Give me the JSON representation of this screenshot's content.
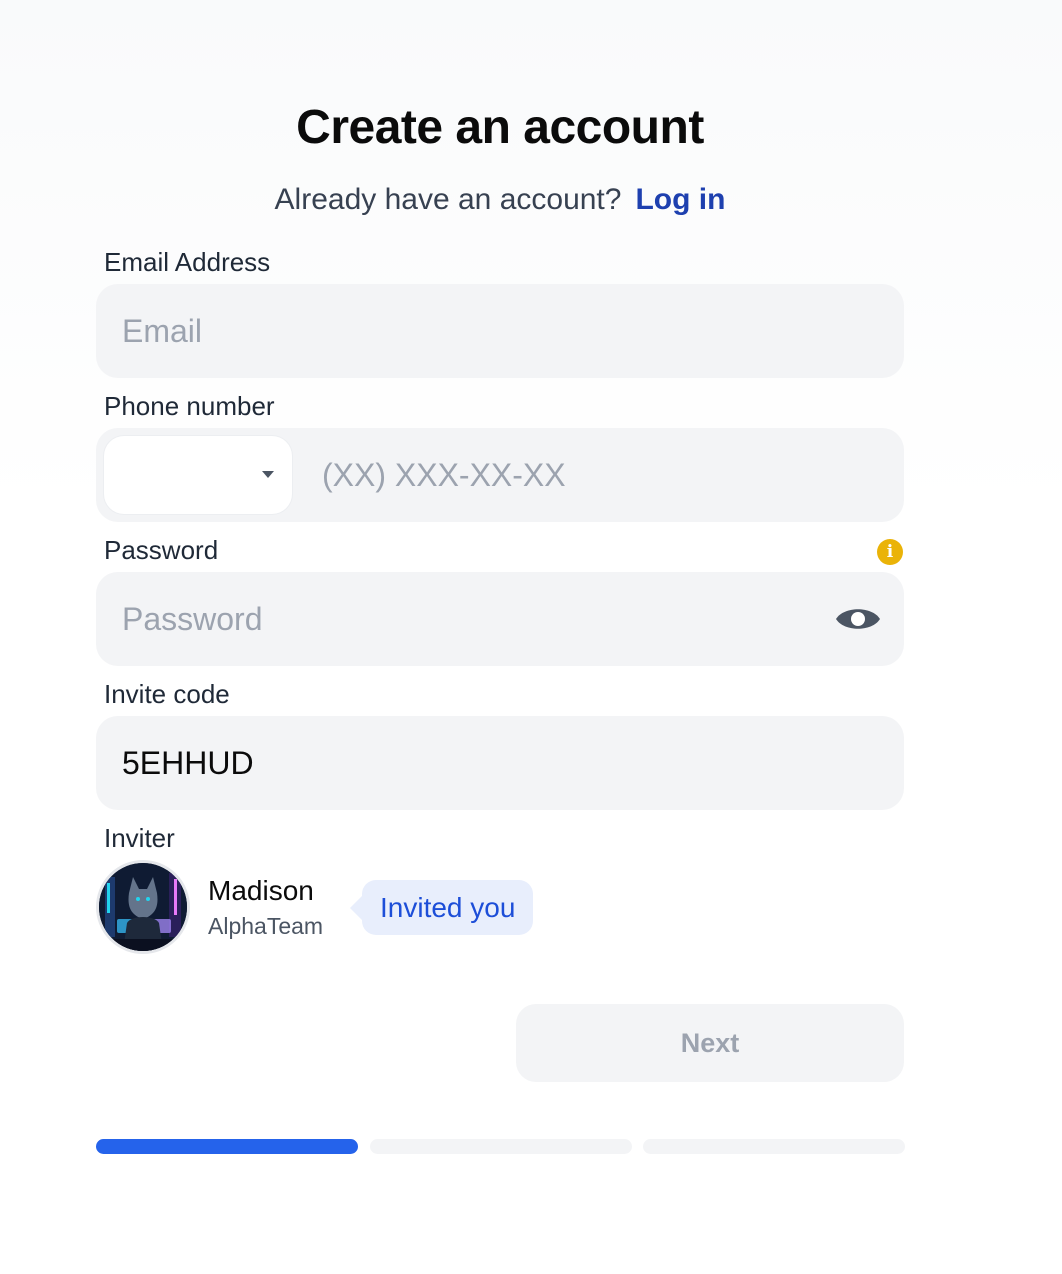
{
  "header": {
    "title": "Create an account",
    "already_have_account": "Already have an account?",
    "login_link": "Log in"
  },
  "form": {
    "email": {
      "label": "Email Address",
      "placeholder": "Email",
      "value": ""
    },
    "phone": {
      "label": "Phone number",
      "country_value": "",
      "placeholder": "(XX) XXX-XX-XX",
      "value": ""
    },
    "password": {
      "label": "Password",
      "placeholder": "Password",
      "value": "",
      "info_icon": "i"
    },
    "invite_code": {
      "label": "Invite code",
      "value": "5EHHUD"
    }
  },
  "inviter": {
    "label": "Inviter",
    "name": "Madison",
    "team": "AlphaTeam",
    "badge": "Invited you"
  },
  "actions": {
    "next_label": "Next"
  },
  "progress": {
    "steps": 3,
    "current_step": 1
  },
  "colors": {
    "accent": "#2563eb",
    "link": "#1e40af",
    "info": "#eab308",
    "input_bg": "#f3f4f6"
  }
}
